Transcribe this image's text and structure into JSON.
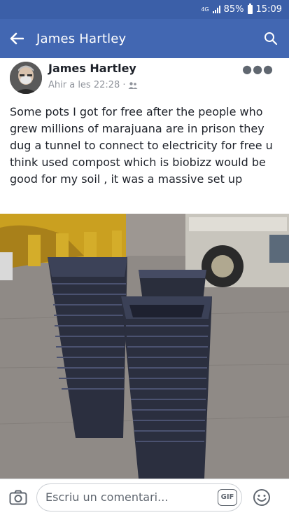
{
  "status_bar": {
    "network": "4G",
    "battery": "85%",
    "time": "15:09"
  },
  "app_bar": {
    "title": "James Hartley",
    "icons": [
      "back-arrow-icon",
      "search-icon"
    ]
  },
  "post": {
    "author": "James Hartley",
    "timestamp": "Ahir a les 22:28",
    "audience_icon": "friends-icon",
    "menu_icon": "more-options-icon",
    "text": "Some pots I got for free after the people who grew millions of marajuana are in prison they dug a tunnel to connect to electricity for free u think used compost which is biobizz would be good for my soil , it was a massive set up"
  },
  "comment_bar": {
    "placeholder": "Escriu un comentari...",
    "gif_label": "GIF",
    "icons": [
      "camera-icon",
      "gif-icon",
      "emoji-icon"
    ]
  },
  "colors": {
    "status_bar": "#3b5fa8",
    "app_bar": "#4267b2",
    "text": "#1d2129",
    "meta": "#90949c"
  }
}
